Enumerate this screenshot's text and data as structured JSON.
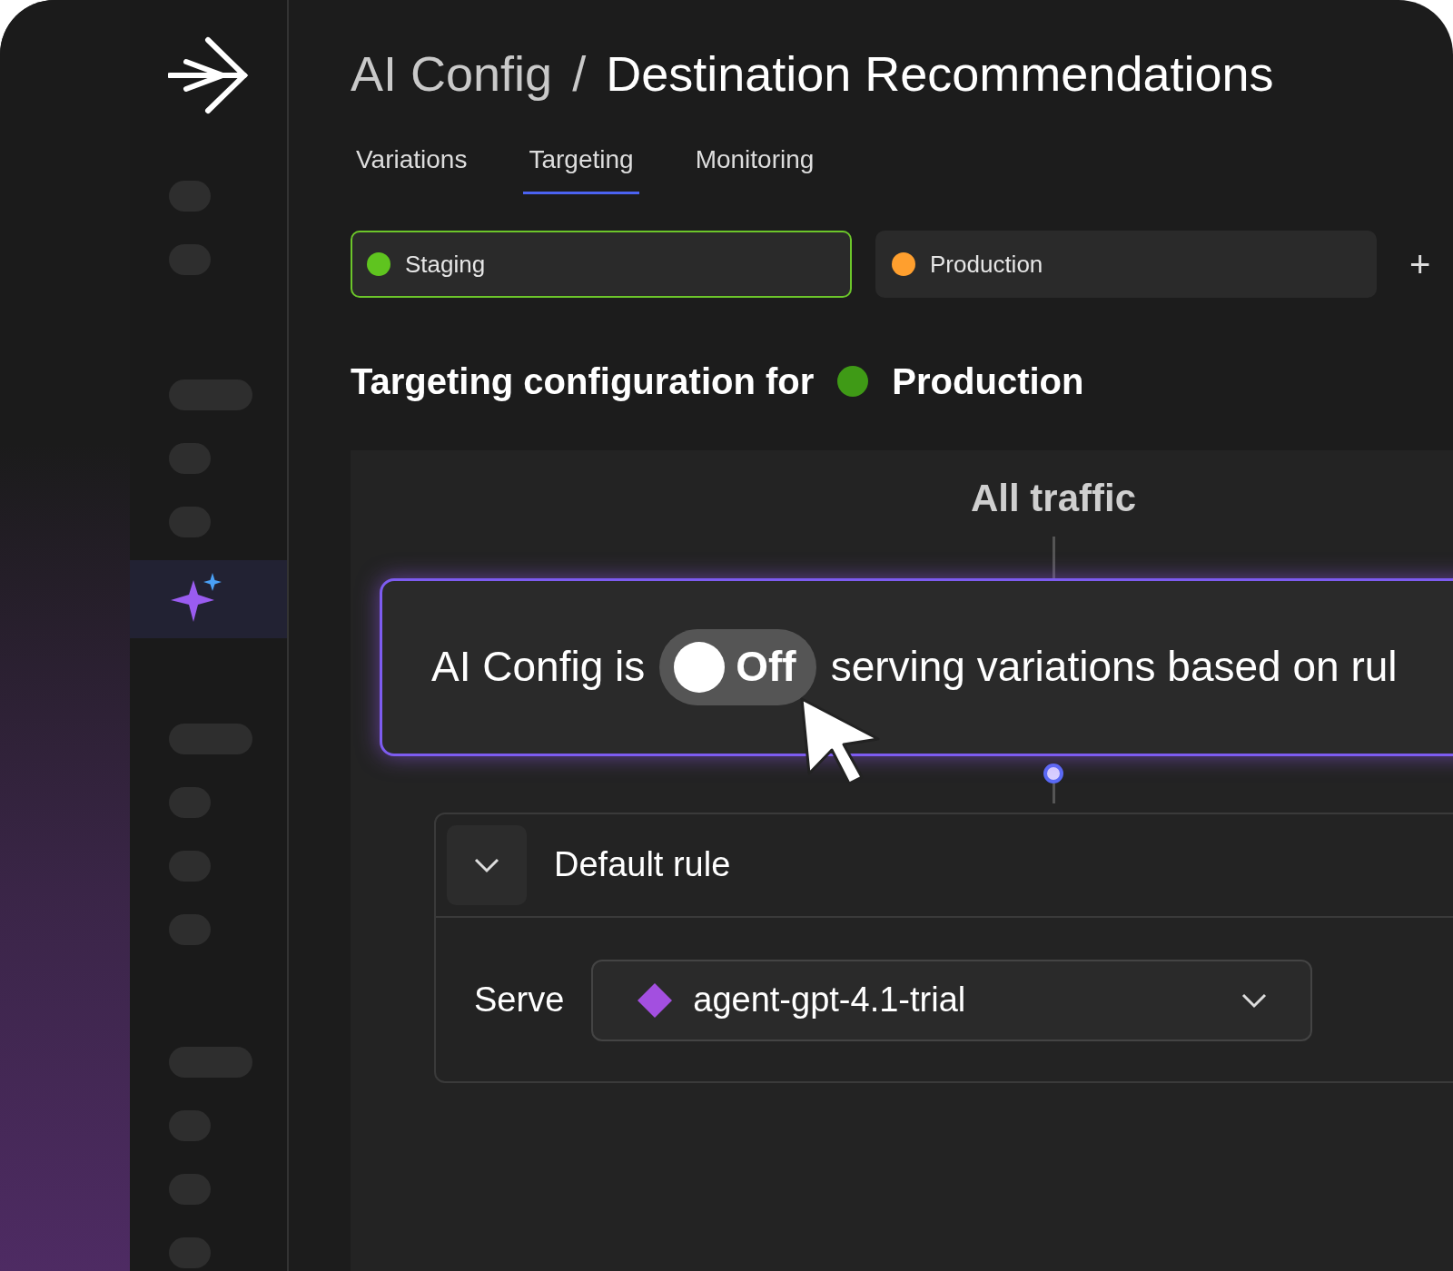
{
  "breadcrumb": {
    "parent": "AI Config",
    "separator": "/",
    "title": "Destination Recommendations"
  },
  "sidebar": {
    "groups": [
      [
        {
          "kind": "short",
          "selected": false
        },
        {
          "kind": "short",
          "selected": false
        }
      ],
      [
        {
          "kind": "long",
          "selected": false
        },
        {
          "kind": "short",
          "selected": false
        },
        {
          "kind": "short",
          "selected": false
        }
      ],
      [
        {
          "kind": "icon",
          "selected": true
        }
      ],
      [
        {
          "kind": "long",
          "selected": false
        },
        {
          "kind": "short",
          "selected": false
        },
        {
          "kind": "short",
          "selected": false
        },
        {
          "kind": "short",
          "selected": false
        }
      ],
      [
        {
          "kind": "long",
          "selected": false
        },
        {
          "kind": "short",
          "selected": false
        },
        {
          "kind": "short",
          "selected": false
        },
        {
          "kind": "short",
          "selected": false
        }
      ]
    ]
  },
  "tabs": [
    {
      "label": "Variations",
      "selected": false
    },
    {
      "label": "Targeting",
      "selected": true
    },
    {
      "label": "Monitoring",
      "selected": false
    }
  ],
  "environments": [
    {
      "name": "Staging",
      "color": "#5fc41f",
      "selected": true
    },
    {
      "name": "Production",
      "color": "#ff9f2e",
      "selected": false
    }
  ],
  "add_button": "+",
  "targeting": {
    "heading": "Targeting configuration for",
    "environment": {
      "name": "Production",
      "color": "#3f9a16"
    }
  },
  "flow": {
    "root_label": "All traffic",
    "status": {
      "prefix": "AI Config is",
      "toggle_label": "Off",
      "on": false,
      "suffix": "serving variations based on rul"
    },
    "rule": {
      "title": "Default rule",
      "expanded": true,
      "serve_label": "Serve",
      "variation": {
        "name": "agent-gpt-4.1-trial",
        "color": "#a34fe0"
      }
    }
  }
}
